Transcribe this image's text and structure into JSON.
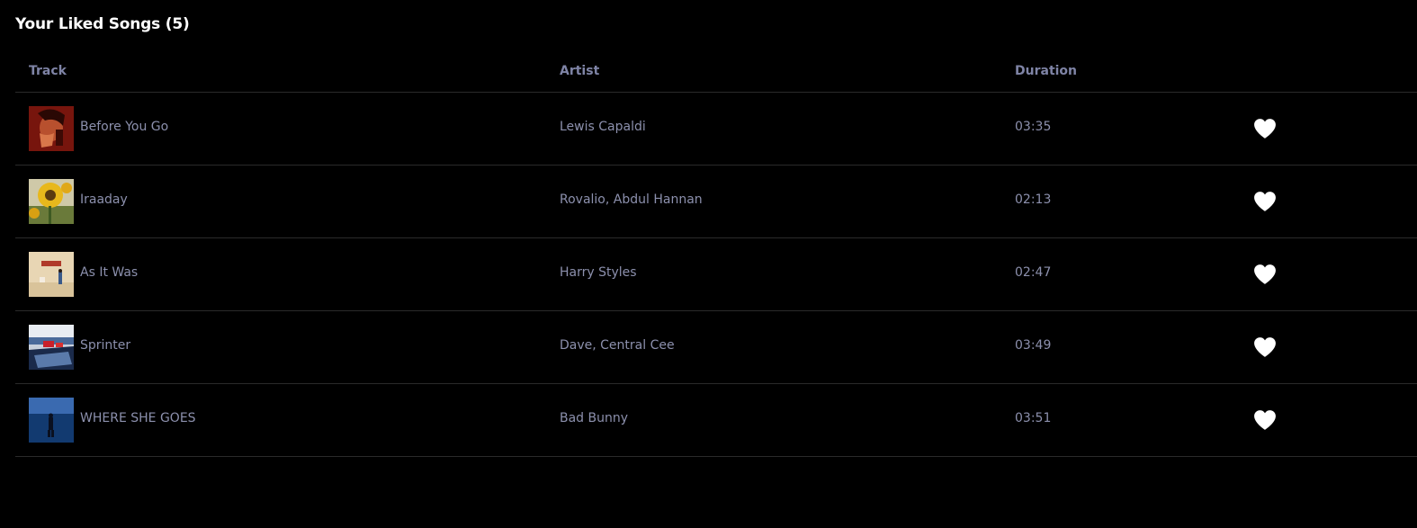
{
  "page": {
    "title": "Your Liked Songs (5)"
  },
  "table": {
    "columns": {
      "track": "Track",
      "artist": "Artist",
      "duration": "Duration"
    },
    "rows": [
      {
        "title": "Before You Go",
        "artist": "Lewis Capaldi",
        "duration": "03:35",
        "liked": true,
        "art_icon": "album-art-red-portrait"
      },
      {
        "title": "Iraaday",
        "artist": "Rovalio, Abdul Hannan",
        "duration": "02:13",
        "liked": true,
        "art_icon": "album-art-sunflower"
      },
      {
        "title": "As It Was",
        "artist": "Harry Styles",
        "duration": "02:47",
        "liked": true,
        "art_icon": "album-art-room"
      },
      {
        "title": "Sprinter",
        "artist": "Dave, Central Cee",
        "duration": "03:49",
        "liked": true,
        "art_icon": "album-art-pool"
      },
      {
        "title": "WHERE SHE GOES",
        "artist": "Bad Bunny",
        "duration": "03:51",
        "liked": true,
        "art_icon": "album-art-blue-figure"
      }
    ]
  },
  "colors": {
    "background": "#000000",
    "text_muted": "#8c90ad",
    "header_text": "#7f84a6",
    "heart": "#ffffff",
    "divider": "#2a2a2a"
  }
}
